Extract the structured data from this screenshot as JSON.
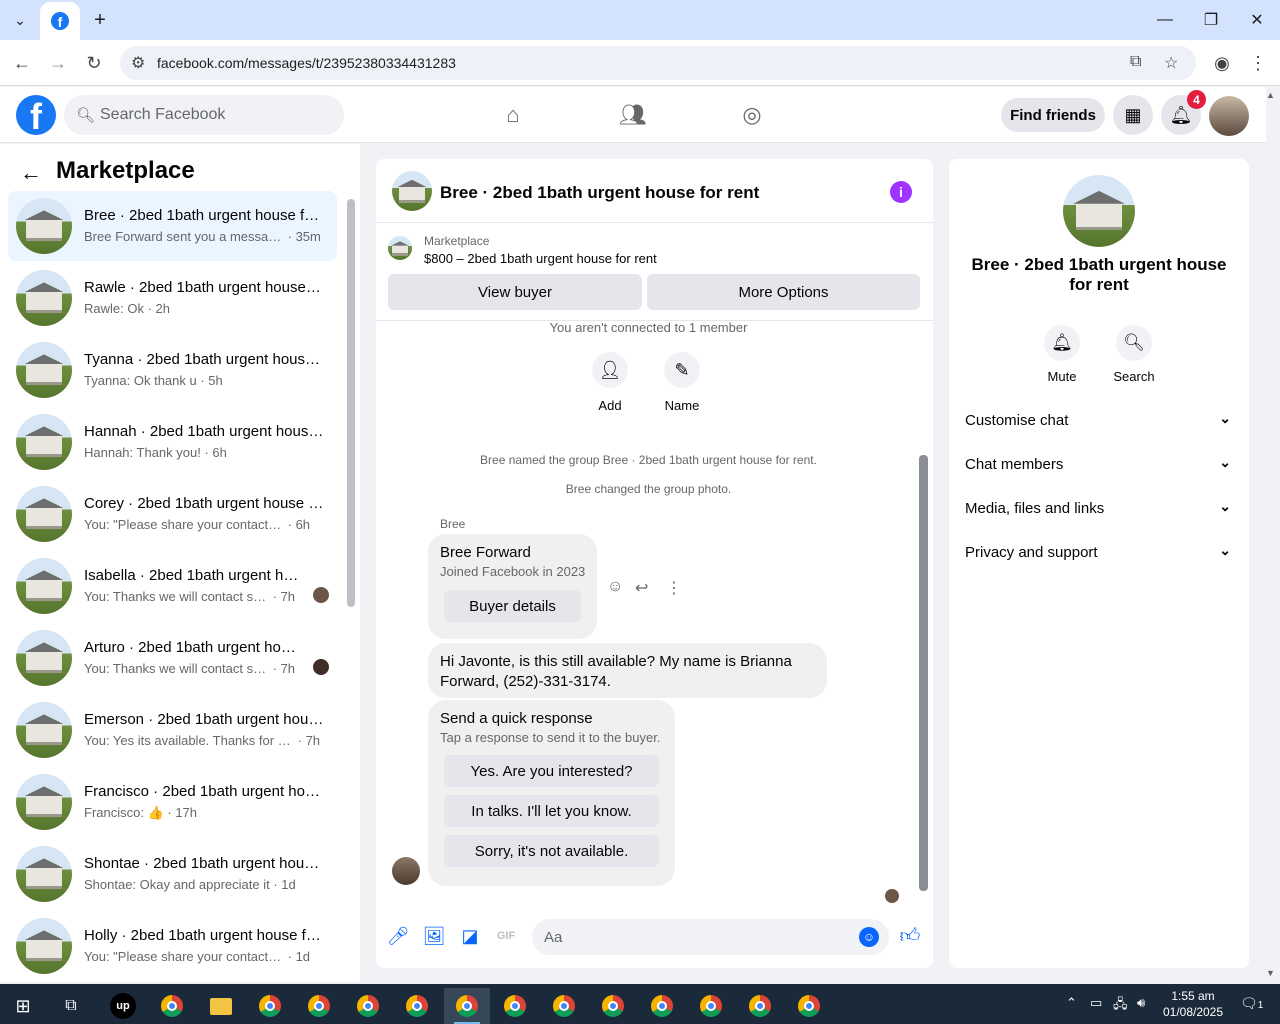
{
  "browser": {
    "url": "facebook.com/messages/t/23952380334431283",
    "new_tab": "+",
    "tabs_menu": "⌄"
  },
  "header": {
    "search_placeholder": "Search Facebook",
    "find_friends": "Find friends",
    "notification_count": "4"
  },
  "sidebar": {
    "title": "Marketplace",
    "conversations": [
      {
        "name": "Bree · 2bed 1bath urgent house for rent",
        "preview": "Bree Forward sent you a message...",
        "time": "35m"
      },
      {
        "name": "Rawle · 2bed 1bath urgent house for rent",
        "preview": "Rawle: Ok",
        "time": "2h"
      },
      {
        "name": "Tyanna · 2bed 1bath urgent house for rent",
        "preview": "Tyanna: Ok thank u",
        "time": "5h"
      },
      {
        "name": "Hannah · 2bed 1bath urgent house for rent",
        "preview": "Hannah: Thank you!",
        "time": "6h"
      },
      {
        "name": "Corey · 2bed 1bath urgent house for rent",
        "preview": "You: \"Please share your contact number\"",
        "time": "6h"
      },
      {
        "name": "Isabella · 2bed 1bath urgent house for rent",
        "preview": "You: Thanks we will contact soon",
        "time": "7h"
      },
      {
        "name": "Arturo · 2bed 1bath urgent house for rent",
        "preview": "You: Thanks we will contact soon",
        "time": "7h"
      },
      {
        "name": "Emerson · 2bed 1bath urgent house for rent",
        "preview": "You: Yes its available. Thanks for message",
        "time": "7h"
      },
      {
        "name": "Francisco · 2bed 1bath urgent house for rent",
        "preview": "Francisco: 👍",
        "time": "17h"
      },
      {
        "name": "Shontae · 2bed 1bath urgent house for rent",
        "preview": "Shontae: Okay and appreciate it",
        "time": "1d"
      },
      {
        "name": "Holly · 2bed 1bath urgent house for rent",
        "preview": "You: \"Please share your contact number\"",
        "time": "1d"
      }
    ]
  },
  "chat": {
    "title": "Bree · 2bed 1bath urgent house for rent",
    "marketplace_label": "Marketplace",
    "listing": "$800 – 2bed 1bath urgent house for rent",
    "view_buyer": "View buyer",
    "more_options": "More Options",
    "not_connected": "You aren't connected to 1 member",
    "add_label": "Add",
    "name_label": "Name",
    "event_named": "Bree named the group Bree · 2bed 1bath urgent house for rent.",
    "event_photo": "Bree changed the group photo.",
    "sender": "Bree",
    "card_name": "Bree Forward",
    "card_joined": "Joined Facebook in 2023",
    "buyer_details": "Buyer details",
    "message_line1": "Hi Javonte, is this still available? My name is Brianna",
    "message_line2": "Forward, (252)-331-3174.",
    "quick_title": "Send a quick response",
    "quick_sub": "Tap a response to send it to the buyer.",
    "quick_responses": [
      "Yes. Are you interested?",
      "In talks. I'll let you know.",
      "Sorry, it's not available."
    ],
    "composer_placeholder": "Aa"
  },
  "right_panel": {
    "title": "Bree · 2bed 1bath urgent house for rent",
    "mute": "Mute",
    "search": "Search",
    "sections": [
      "Customise chat",
      "Chat members",
      "Media, files and links",
      "Privacy and support"
    ]
  },
  "taskbar": {
    "time": "1:55 am",
    "date": "01/08/2025",
    "notif_count": "1"
  },
  "colors": {
    "brand": "#1877f2",
    "messenger_accent": "#0866ff",
    "info_purple": "#a033ff",
    "badge_red": "#e41e3f"
  }
}
